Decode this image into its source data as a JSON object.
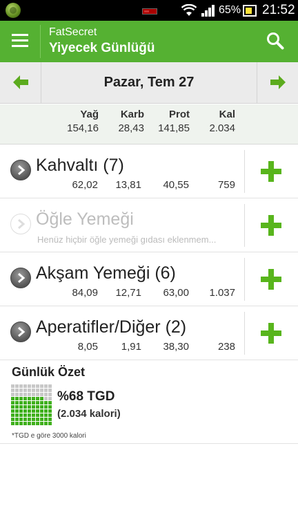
{
  "status_bar": {
    "battery_percent": "65%",
    "time": "21:52",
    "icons": [
      "fatsecret-app-icon",
      "battery-alert-icon",
      "wifi-icon",
      "signal-icon",
      "battery-icon"
    ]
  },
  "app_bar": {
    "app_name": "FatSecret",
    "title": "Yiyecek Günlüğü",
    "icons": [
      "menu-icon",
      "search-icon"
    ]
  },
  "date_nav": {
    "date": "Pazar, Tem 27",
    "icons": [
      "arrow-left-icon",
      "arrow-right-icon"
    ]
  },
  "totals": {
    "headers": [
      "Yağ",
      "Karb",
      "Prot",
      "Kal"
    ],
    "values": [
      "154,16",
      "28,43",
      "141,85",
      "2.034"
    ]
  },
  "meals": [
    {
      "name": "Kahvaltı (7)",
      "values": [
        "62,02",
        "13,81",
        "40,55",
        "759"
      ],
      "empty_text": ""
    },
    {
      "name": "Öğle Yemeği",
      "values": [],
      "empty_text": "Henüz hiçbir öğle yemeği gıdası eklenmem..."
    },
    {
      "name": "Akşam Yemeği (6)",
      "values": [
        "84,09",
        "12,71",
        "63,00",
        "1.037"
      ],
      "empty_text": ""
    },
    {
      "name": "Aperatifler/Diğer (2)",
      "values": [
        "8,05",
        "1,91",
        "38,30",
        "238"
      ],
      "empty_text": ""
    }
  ],
  "summary": {
    "title": "Günlük Özet",
    "rdi_text": "%68 TGD",
    "rdi_percent": 68,
    "calories_text": "(2.034 kalori)",
    "note": "*TGD e göre 3000 kalori"
  },
  "colors": {
    "accent": "#55b132",
    "add_button": "#58b51c",
    "grid_on": "#3fb01c",
    "grid_off": "#c8c8c8"
  }
}
